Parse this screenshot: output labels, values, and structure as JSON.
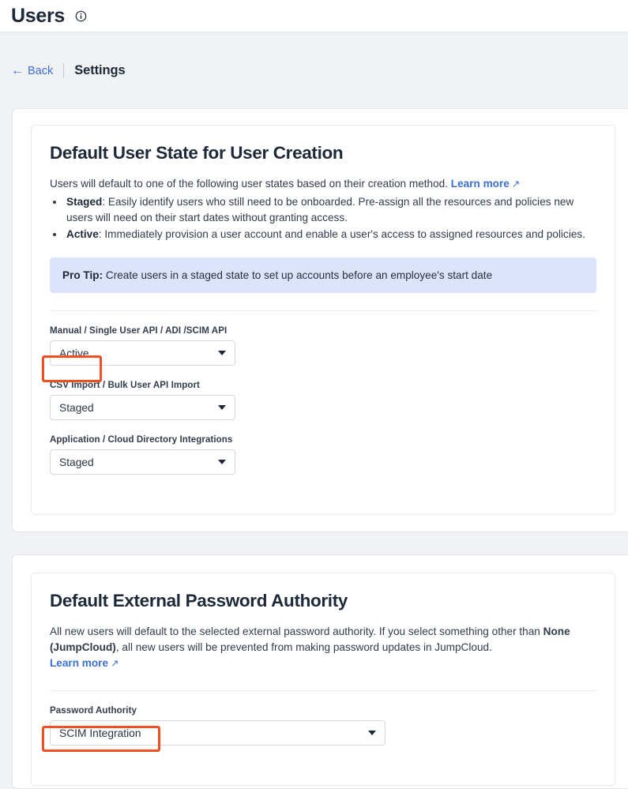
{
  "header": {
    "title": "Users",
    "info_icon": "info-circle-icon"
  },
  "breadcrumb": {
    "back_label": "Back",
    "back_arrow": "←",
    "current": "Settings"
  },
  "colors": {
    "accent_link": "#3b6fd4",
    "highlight": "#f04e23",
    "protip_bg": "#dbe4fb",
    "page_bg": "#f1f2f4",
    "text": "#1d2939"
  },
  "user_state_card": {
    "title": "Default User State for User Creation",
    "desc_intro": "Users will default to one of the following user states based on their creation method.",
    "learn_more_label": "Learn more",
    "learn_more_arrow": "↗",
    "bullets": [
      {
        "term": "Staged",
        "text": ": Easily identify users who still need to be onboarded. Pre-assign all the resources and policies new users will need on their start dates without granting access."
      },
      {
        "term": "Active",
        "text": ": Immediately provision a user account and enable a user's access to assigned resources and policies."
      }
    ],
    "protip_label": "Pro Tip:",
    "protip_text": "Create users in a staged state to set up accounts before an employee's start date",
    "fields": [
      {
        "label": "Manual / Single User API / ADI /SCIM API",
        "value": "Active",
        "name": "manual-single-user-api-select"
      },
      {
        "label": "CSV Import / Bulk User API Import",
        "value": "Staged",
        "name": "csv-import-bulk-user-api-select"
      },
      {
        "label": "Application / Cloud Directory Integrations",
        "value": "Staged",
        "name": "application-cloud-directory-integrations-select"
      }
    ]
  },
  "password_authority_card": {
    "title": "Default External Password Authority",
    "desc_part1": "All new users will default to the selected external password authority. If you select something other than ",
    "desc_bold": "None (JumpCloud)",
    "desc_part2": ", all new users will be prevented from making password updates in JumpCloud.",
    "learn_more_label": "Learn more",
    "learn_more_arrow": "↗",
    "field": {
      "label": "Password Authority",
      "value": "SCIM Integration",
      "name": "password-authority-select"
    }
  }
}
